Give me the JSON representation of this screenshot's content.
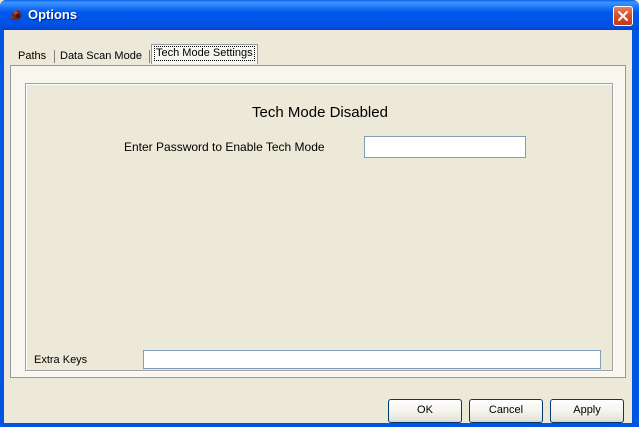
{
  "window": {
    "title": "Options"
  },
  "tabs": [
    {
      "label": "Paths"
    },
    {
      "label": "Data Scan Mode"
    },
    {
      "label": "Tech Mode Settings",
      "selected": true
    }
  ],
  "tech_mode": {
    "heading": "Tech Mode Disabled",
    "password_label": "Enter Password to Enable Tech Mode",
    "password_value": "",
    "extra_keys_label": "Extra Keys",
    "extra_keys_value": ""
  },
  "buttons": {
    "ok": "OK",
    "cancel": "Cancel",
    "apply": "Apply"
  },
  "colors": {
    "titlebar": "#0058ee",
    "close_button": "#d8502d",
    "dialog_face": "#ece9d8",
    "tab_panel": "#f7f6ef"
  },
  "icons": {
    "app": "options-app-icon",
    "close": "close-icon"
  }
}
